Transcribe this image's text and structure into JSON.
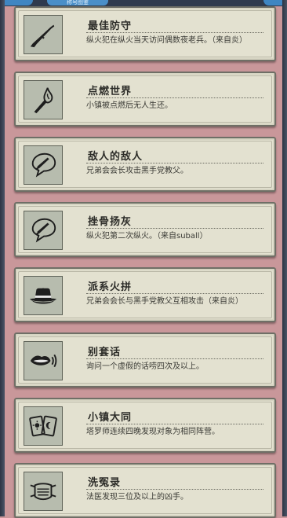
{
  "header": {
    "tab_label": "称号图鉴"
  },
  "achievements": [
    {
      "icon": "rifle-icon",
      "title": "最佳防守",
      "desc": "纵火犯在纵火当天访问偶数夜老兵。（来自炎）"
    },
    {
      "icon": "torch-icon",
      "title": "点燃世界",
      "desc": "小镇被点燃后无人生还。"
    },
    {
      "icon": "speech-knife-icon",
      "title": "敌人的敌人",
      "desc": "兄弟会会长攻击黑手党教父。"
    },
    {
      "icon": "speech-knife-icon",
      "title": "挫骨扬灰",
      "desc": "纵火犯第二次纵火。（来自suball）"
    },
    {
      "icon": "fedora-hat-icon",
      "title": "派系火拼",
      "desc": "兄弟会会长与黑手党教父互相攻击（来自炎）"
    },
    {
      "icon": "mouth-sound-icon",
      "title": "别套话",
      "desc": "询问一个虚假的话唠四次及以上。"
    },
    {
      "icon": "tarot-cards-icon",
      "title": "小镇大同",
      "desc": "塔罗师连续四晚发现对象为相同阵营。"
    },
    {
      "icon": "face-mask-icon",
      "title": "洗冤录",
      "desc": "法医发现三位及以上的凶手。"
    }
  ]
}
